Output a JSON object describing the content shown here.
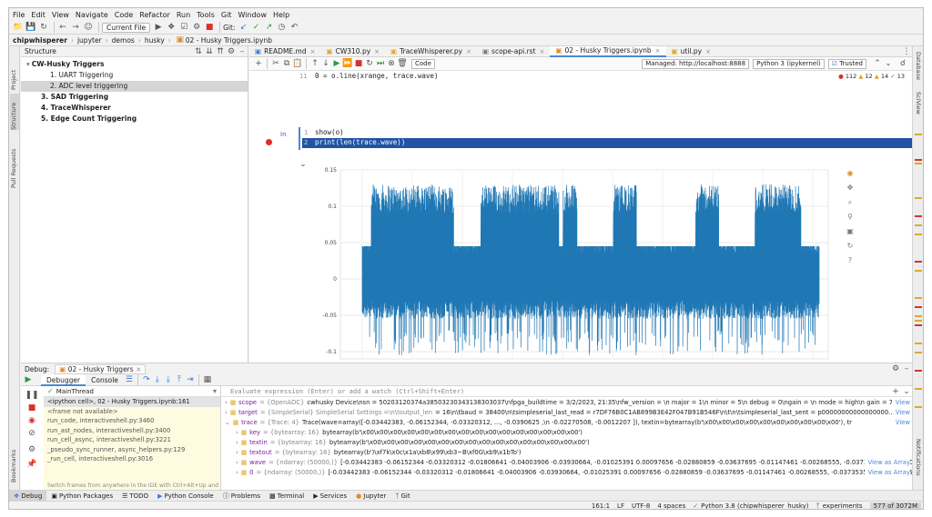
{
  "menu": [
    "File",
    "Edit",
    "View",
    "Navigate",
    "Code",
    "Refactor",
    "Run",
    "Tools",
    "Git",
    "Window",
    "Help"
  ],
  "toolbar": {
    "run_config": "Current File",
    "git_label": "Git:"
  },
  "breadcrumb": [
    "chipwhisperer",
    "jupyter",
    "demos",
    "husky",
    "02 - Husky Triggers.ipynb"
  ],
  "left_stripe": [
    "Project",
    "Structure",
    "Pull Requests",
    "Bookmarks"
  ],
  "right_stripe": [
    "Database",
    "SciView",
    "Notifications"
  ],
  "structure": {
    "title": "Structure",
    "items": [
      {
        "label": "CW-Husky Triggers",
        "level": 0,
        "bold": true
      },
      {
        "label": "1. UART Triggering",
        "level": 1,
        "bold": false
      },
      {
        "label": "2. ADC level triggering",
        "level": 1,
        "bold": false,
        "selected": true
      },
      {
        "label": "3. SAD Triggering",
        "level": 0,
        "bold": true
      },
      {
        "label": "4. TraceWhisperer",
        "level": 0,
        "bold": true
      },
      {
        "label": "5. Edge Count Triggering",
        "level": 0,
        "bold": true
      }
    ]
  },
  "editor": {
    "tabs": [
      {
        "label": "README.md",
        "active": false
      },
      {
        "label": "CW310.py",
        "active": false
      },
      {
        "label": "TraceWhisperer.py",
        "active": false
      },
      {
        "label": "scope-api.rst",
        "active": false
      },
      {
        "label": "02 - Husky Triggers.ipynb",
        "active": true
      },
      {
        "label": "util.py",
        "active": false
      }
    ],
    "nb": {
      "cell_type": "Code",
      "server": "Managed: http://localhost:8888",
      "kernel": "Python 3 (ipykernel)",
      "trusted": "Trusted",
      "errors": "112",
      "warnings": "12",
      "weak": "14",
      "ok": "13"
    },
    "line11_num": "11",
    "line11_code": "0 = o.line(xrange, trace.wave)",
    "in_prompt": "In",
    "cell_lines": [
      {
        "num": "1",
        "code": "show(o)"
      },
      {
        "num": "2",
        "code": "print(len(trace.wave))"
      }
    ]
  },
  "chart_data": {
    "type": "line",
    "y_ticks": [
      "0.15",
      "0.1",
      "0.05",
      "0",
      "-0.05",
      "-0.1"
    ],
    "ylim": [
      -0.11,
      0.15
    ],
    "series": [
      {
        "color": "#1f77b4",
        "points": 50000
      }
    ],
    "grid": true
  },
  "debug": {
    "label": "Debug:",
    "session": "02 - Husky Triggers",
    "tabs": [
      "Debugger",
      "Console"
    ],
    "thread": "MainThread",
    "eval_placeholder": "Evaluate expression (Enter) or add a watch (Ctrl+Shift+Enter)",
    "frames": [
      {
        "label": "<ipython cell>, 02 - Husky Triggers.ipynb:161",
        "selected": true
      },
      {
        "label": "<frame not available>",
        "selected": false
      },
      {
        "label": "run_code, interactiveshell.py:3460",
        "selected": false
      },
      {
        "label": "run_ast_nodes, interactiveshell.py:3400",
        "selected": false
      },
      {
        "label": "run_cell_async, interactiveshell.py:3221",
        "selected": false
      },
      {
        "label": "_pseudo_sync_runner, async_helpers.py:129",
        "selected": false
      },
      {
        "label": "_run_cell, interactiveshell.py:3016",
        "selected": false
      }
    ],
    "frames_hint": "Switch frames from anywhere in the IDE with Ctrl+Alt+Up and ...",
    "vars": [
      {
        "indent": 0,
        "name": "scope",
        "type": "= {OpenADC}",
        "value": "cwhusky Device\\nsn = 50203120374a38503230343138303037\\nfpga_buildtime = 3/2/2023, 21:35\\nfw_version = \\n major = 1\\n minor = 5\\n debug = 0\\ngain = \\n mode = high\\n gain = 7\\n db",
        "link": "View"
      },
      {
        "indent": 0,
        "name": "target",
        "type": "= {SimpleSerial} SimpleSerial Settings =\\n\\toutput_len",
        "value": "= 16\\n\\tbaud = 38400\\n\\tsimpleserial_last_read = r7DF76B0C1AB899B3E42F047B91B546F\\n\\t\\n\\tsimpleserial_last_sent = p00000000000000000...",
        "link": "View"
      },
      {
        "indent": 0,
        "name": "trace",
        "type": "= {Trace: 4}",
        "value": "Trace(wave=array([-0.03442383, -0.06152344, -0.03320312, ..., -0.0390625 ,\\n -0.02270508, -0.0012207 ]), textin=bytearray(b'\\x00\\x00\\x00\\x00\\x00\\x00\\x00\\x00\\x00\\x00'), tr",
        "link": "View"
      },
      {
        "indent": 1,
        "name": "key",
        "type": "= {bytearray: 16}",
        "value": "bytearray(b'\\x00\\x00\\x00\\x00\\x00\\x00\\x00\\x00\\x00\\x00\\x00\\x00\\x00\\x00\\x00\\x00')",
        "link": ""
      },
      {
        "indent": 1,
        "name": "textin",
        "type": "= {bytearray: 16}",
        "value": "bytearray(b'\\x00\\x00\\x00\\x00\\x00\\x00\\x00\\x00\\x00\\x00\\x00\\x00\\x00\\x00\\x00\\x00')",
        "link": ""
      },
      {
        "indent": 1,
        "name": "textout",
        "type": "= {bytearray: 16}",
        "value": "bytearray(b')\\xf7k\\x0c\\x1a\\xb8\\x99\\xb3~B\\xf0G\\xb9\\x1bTo')",
        "link": ""
      },
      {
        "indent": 1,
        "name": "wave",
        "type": "= {ndarray: (50000,)}",
        "value": "[-0.03442383 -0.06152344 -0.03320312 -0.01806641 -0.04003906 -0.03930664, -0.01025391 0.00097656 -0.02880859 -0.03637695 -0.01147461 -0.00268555, -0.03735352 -0.079101",
        "link": "View as Array"
      },
      {
        "indent": 1,
        "name": "0",
        "type": "= {ndarray: (50000,)}",
        "value": "[-0.03442383 -0.06152344 -0.03320312 -0.01806641 -0.04003906 -0.03930664, -0.01025391 0.00097656 -0.02880859 -0.03637695 -0.01147461 -0.00268555, -0.03735352 -0.07910156",
        "link": "View as Array"
      }
    ]
  },
  "bottom_tabs": [
    "Debug",
    "Python Packages",
    "TODO",
    "Python Console",
    "Problems",
    "Terminal",
    "Services",
    "Jupyter",
    "Git"
  ],
  "status": {
    "position": "161:1",
    "line_sep": "LF",
    "encoding": "UTF-8",
    "indent": "4 spaces",
    "interpreter": "Python 3.8 (chipwhisperer_husky)",
    "branch": "experiments",
    "memory": "577 of 3072M"
  },
  "colors": {
    "accent": "#4a88d6",
    "trace": "#1f77b4",
    "selection": "#2153a5",
    "breakpoint": "#d9302c"
  }
}
